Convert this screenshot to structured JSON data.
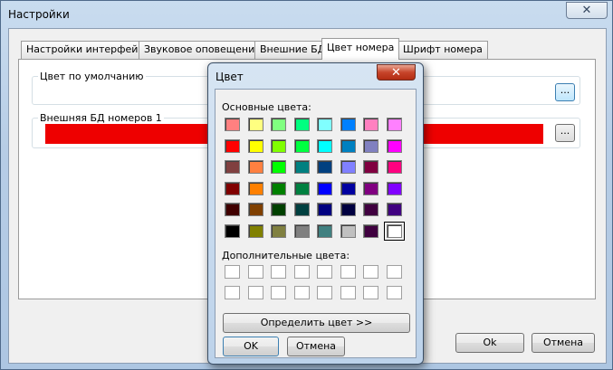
{
  "window": {
    "title": "Настройки",
    "close_glyph": "✕"
  },
  "tabs": [
    {
      "label": "Настройки интерфейса",
      "active": false
    },
    {
      "label": "Звуковое оповещение",
      "active": false
    },
    {
      "label": "Внешние БД",
      "active": false
    },
    {
      "label": "Цвет номера",
      "active": true
    },
    {
      "label": "Шрифт номера",
      "active": false
    }
  ],
  "groups": {
    "default_color": {
      "label": "Цвет по умолчанию",
      "button": "..."
    },
    "external_db": {
      "label": "Внешняя БД номеров 1",
      "button": "...",
      "color": "#ee0000"
    }
  },
  "buttons": {
    "ok": "Ok",
    "cancel": "Отмена"
  },
  "color_dialog": {
    "title": "Цвет",
    "close_glyph": "✕",
    "basic_colors_label": "Основные цвета:",
    "custom_colors_label": "Дополнительные цвета:",
    "define_button": "Определить цвет >>",
    "ok_button": "OK",
    "cancel_button": "Отмена",
    "selected_index": 47,
    "basic_colors": [
      "#ff8080",
      "#ffff80",
      "#80ff80",
      "#00ff80",
      "#80ffff",
      "#0080ff",
      "#ff80c0",
      "#ff80ff",
      "#ff0000",
      "#ffff00",
      "#80ff00",
      "#00ff40",
      "#00ffff",
      "#0080c0",
      "#8080c0",
      "#ff00ff",
      "#804040",
      "#ff8040",
      "#00ff00",
      "#008080",
      "#004080",
      "#8080ff",
      "#800040",
      "#ff0080",
      "#800000",
      "#ff8000",
      "#008000",
      "#008040",
      "#0000ff",
      "#0000a0",
      "#800080",
      "#8000ff",
      "#400000",
      "#804000",
      "#004000",
      "#004040",
      "#000080",
      "#000040",
      "#400040",
      "#400080",
      "#000000",
      "#808000",
      "#808040",
      "#808080",
      "#408080",
      "#c0c0c0",
      "#400040",
      "#ffffff"
    ],
    "custom_colors": [
      "#ffffff",
      "#ffffff",
      "#ffffff",
      "#ffffff",
      "#ffffff",
      "#ffffff",
      "#ffffff",
      "#ffffff",
      "#ffffff",
      "#ffffff",
      "#ffffff",
      "#ffffff",
      "#ffffff",
      "#ffffff",
      "#ffffff",
      "#ffffff"
    ]
  }
}
